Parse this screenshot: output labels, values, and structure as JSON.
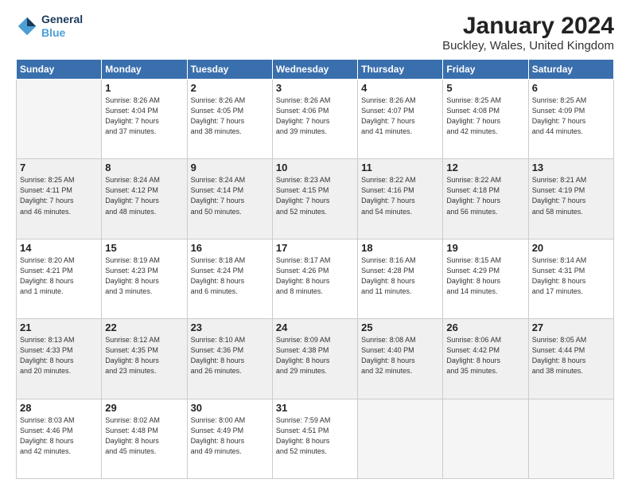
{
  "header": {
    "logo_line1": "General",
    "logo_line2": "Blue",
    "month_title": "January 2024",
    "location": "Buckley, Wales, United Kingdom"
  },
  "days_of_week": [
    "Sunday",
    "Monday",
    "Tuesday",
    "Wednesday",
    "Thursday",
    "Friday",
    "Saturday"
  ],
  "weeks": [
    {
      "shaded": false,
      "days": [
        {
          "num": "",
          "info": ""
        },
        {
          "num": "1",
          "info": "Sunrise: 8:26 AM\nSunset: 4:04 PM\nDaylight: 7 hours\nand 37 minutes."
        },
        {
          "num": "2",
          "info": "Sunrise: 8:26 AM\nSunset: 4:05 PM\nDaylight: 7 hours\nand 38 minutes."
        },
        {
          "num": "3",
          "info": "Sunrise: 8:26 AM\nSunset: 4:06 PM\nDaylight: 7 hours\nand 39 minutes."
        },
        {
          "num": "4",
          "info": "Sunrise: 8:26 AM\nSunset: 4:07 PM\nDaylight: 7 hours\nand 41 minutes."
        },
        {
          "num": "5",
          "info": "Sunrise: 8:25 AM\nSunset: 4:08 PM\nDaylight: 7 hours\nand 42 minutes."
        },
        {
          "num": "6",
          "info": "Sunrise: 8:25 AM\nSunset: 4:09 PM\nDaylight: 7 hours\nand 44 minutes."
        }
      ]
    },
    {
      "shaded": true,
      "days": [
        {
          "num": "7",
          "info": "Sunrise: 8:25 AM\nSunset: 4:11 PM\nDaylight: 7 hours\nand 46 minutes."
        },
        {
          "num": "8",
          "info": "Sunrise: 8:24 AM\nSunset: 4:12 PM\nDaylight: 7 hours\nand 48 minutes."
        },
        {
          "num": "9",
          "info": "Sunrise: 8:24 AM\nSunset: 4:14 PM\nDaylight: 7 hours\nand 50 minutes."
        },
        {
          "num": "10",
          "info": "Sunrise: 8:23 AM\nSunset: 4:15 PM\nDaylight: 7 hours\nand 52 minutes."
        },
        {
          "num": "11",
          "info": "Sunrise: 8:22 AM\nSunset: 4:16 PM\nDaylight: 7 hours\nand 54 minutes."
        },
        {
          "num": "12",
          "info": "Sunrise: 8:22 AM\nSunset: 4:18 PM\nDaylight: 7 hours\nand 56 minutes."
        },
        {
          "num": "13",
          "info": "Sunrise: 8:21 AM\nSunset: 4:19 PM\nDaylight: 7 hours\nand 58 minutes."
        }
      ]
    },
    {
      "shaded": false,
      "days": [
        {
          "num": "14",
          "info": "Sunrise: 8:20 AM\nSunset: 4:21 PM\nDaylight: 8 hours\nand 1 minute."
        },
        {
          "num": "15",
          "info": "Sunrise: 8:19 AM\nSunset: 4:23 PM\nDaylight: 8 hours\nand 3 minutes."
        },
        {
          "num": "16",
          "info": "Sunrise: 8:18 AM\nSunset: 4:24 PM\nDaylight: 8 hours\nand 6 minutes."
        },
        {
          "num": "17",
          "info": "Sunrise: 8:17 AM\nSunset: 4:26 PM\nDaylight: 8 hours\nand 8 minutes."
        },
        {
          "num": "18",
          "info": "Sunrise: 8:16 AM\nSunset: 4:28 PM\nDaylight: 8 hours\nand 11 minutes."
        },
        {
          "num": "19",
          "info": "Sunrise: 8:15 AM\nSunset: 4:29 PM\nDaylight: 8 hours\nand 14 minutes."
        },
        {
          "num": "20",
          "info": "Sunrise: 8:14 AM\nSunset: 4:31 PM\nDaylight: 8 hours\nand 17 minutes."
        }
      ]
    },
    {
      "shaded": true,
      "days": [
        {
          "num": "21",
          "info": "Sunrise: 8:13 AM\nSunset: 4:33 PM\nDaylight: 8 hours\nand 20 minutes."
        },
        {
          "num": "22",
          "info": "Sunrise: 8:12 AM\nSunset: 4:35 PM\nDaylight: 8 hours\nand 23 minutes."
        },
        {
          "num": "23",
          "info": "Sunrise: 8:10 AM\nSunset: 4:36 PM\nDaylight: 8 hours\nand 26 minutes."
        },
        {
          "num": "24",
          "info": "Sunrise: 8:09 AM\nSunset: 4:38 PM\nDaylight: 8 hours\nand 29 minutes."
        },
        {
          "num": "25",
          "info": "Sunrise: 8:08 AM\nSunset: 4:40 PM\nDaylight: 8 hours\nand 32 minutes."
        },
        {
          "num": "26",
          "info": "Sunrise: 8:06 AM\nSunset: 4:42 PM\nDaylight: 8 hours\nand 35 minutes."
        },
        {
          "num": "27",
          "info": "Sunrise: 8:05 AM\nSunset: 4:44 PM\nDaylight: 8 hours\nand 38 minutes."
        }
      ]
    },
    {
      "shaded": false,
      "days": [
        {
          "num": "28",
          "info": "Sunrise: 8:03 AM\nSunset: 4:46 PM\nDaylight: 8 hours\nand 42 minutes."
        },
        {
          "num": "29",
          "info": "Sunrise: 8:02 AM\nSunset: 4:48 PM\nDaylight: 8 hours\nand 45 minutes."
        },
        {
          "num": "30",
          "info": "Sunrise: 8:00 AM\nSunset: 4:49 PM\nDaylight: 8 hours\nand 49 minutes."
        },
        {
          "num": "31",
          "info": "Sunrise: 7:59 AM\nSunset: 4:51 PM\nDaylight: 8 hours\nand 52 minutes."
        },
        {
          "num": "",
          "info": ""
        },
        {
          "num": "",
          "info": ""
        },
        {
          "num": "",
          "info": ""
        }
      ]
    }
  ]
}
